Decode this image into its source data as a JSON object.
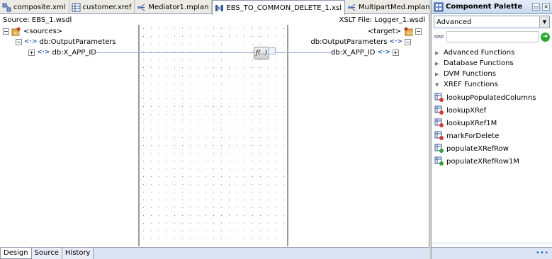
{
  "tabs": [
    {
      "label": "composite.xml",
      "icon": "composite-icon"
    },
    {
      "label": "customer.xref",
      "icon": "xref-table-icon"
    },
    {
      "label": "Mediator1.mplan",
      "icon": "mediator-icon"
    },
    {
      "label": "EBS_TO_COMMON_DELETE_1.xsl",
      "icon": "xsl-map-icon",
      "active": true
    },
    {
      "label": "MultipartMed.mplan",
      "icon": "mediator-icon"
    }
  ],
  "source": {
    "title": "Source: EBS_1.wsdl",
    "root": "<sources>",
    "child": "db:OutputParameters",
    "leaf": "db:X_APP_ID"
  },
  "target": {
    "title": "XSLT File: Logger_1.wsdl",
    "root": "<target>",
    "child": "db:OutputParameters",
    "leaf": "db:X_APP_ID"
  },
  "function_box": {
    "label": "f(..)"
  },
  "bottom_tabs": [
    "Design",
    "Source",
    "History"
  ],
  "palette": {
    "title": "Component Palette",
    "selected": "Advanced",
    "search_value": "",
    "sections": [
      {
        "label": "Advanced Functions",
        "expanded": false
      },
      {
        "label": "Database Functions",
        "expanded": false
      },
      {
        "label": "DVM Functions",
        "expanded": false
      },
      {
        "label": "XREF Functions",
        "expanded": true
      }
    ],
    "items": [
      "lookupPopulatedColumns",
      "lookupXRef",
      "lookupXRef1M",
      "markForDelete",
      "populateXRefRow",
      "populateXRefRow1M"
    ],
    "footer": "•••"
  },
  "colors": {
    "link": "#9ab0d8",
    "accent": "#2e5aa8",
    "go": "#2fa62f"
  }
}
